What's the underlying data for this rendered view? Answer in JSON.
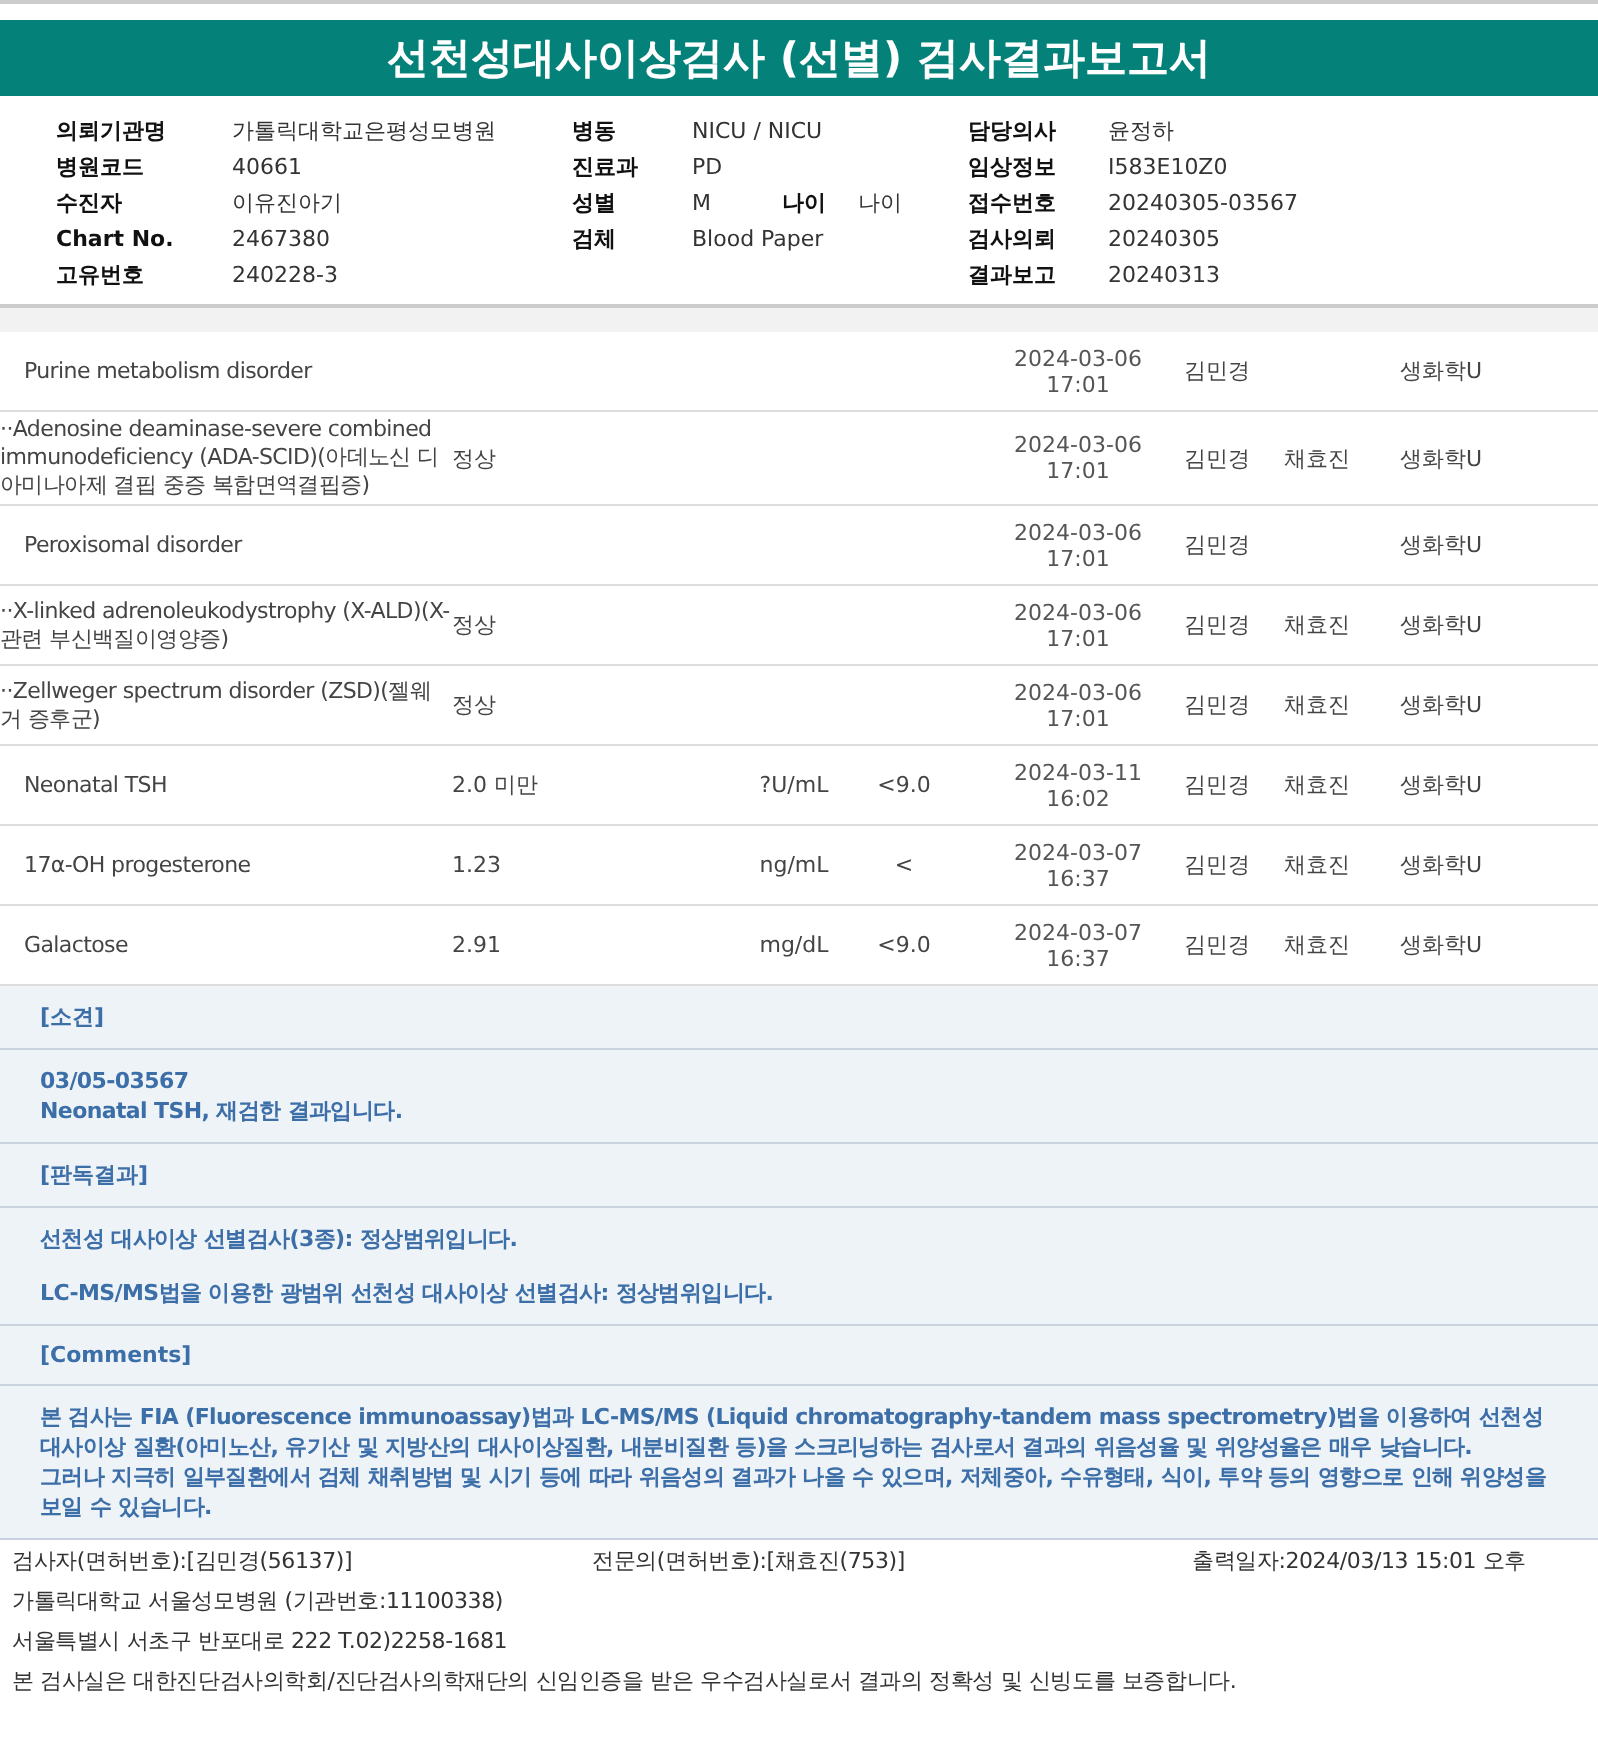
{
  "title": "선천성대사이상검사 (선별) 검사결과보고서",
  "info": [
    [
      {
        "label": "의뢰기관명",
        "value": "가톨릭대학교은평성모병원"
      },
      {
        "label": "병원코드",
        "value": "40661"
      },
      {
        "label": "수진자",
        "value": "이유진아기"
      },
      {
        "label": "Chart No.",
        "value": "2467380"
      },
      {
        "label": "고유번호",
        "value": "240228-3"
      }
    ],
    [
      {
        "label": "병동",
        "value": "NICU / NICU"
      },
      {
        "label": "진료과",
        "value": "PD"
      },
      {
        "label": "성별",
        "value": "M",
        "extra_label": "나이",
        "extra_value": "나이"
      },
      {
        "label": "검체",
        "value": "Blood Paper"
      }
    ],
    [
      {
        "label": "담당의사",
        "value": "윤정하"
      },
      {
        "label": "임상정보",
        "value": "I583E10Z0"
      },
      {
        "label": "접수번호",
        "value": "20240305-03567"
      },
      {
        "label": "검사의뢰",
        "value": "20240305"
      },
      {
        "label": "결과보고",
        "value": "20240313"
      }
    ]
  ],
  "rows": [
    {
      "name": "Purine metabolism disorder",
      "date": "2024-03-06",
      "time": "17:01",
      "tester": "김민경",
      "department": "생화학U"
    },
    {
      "name": "··Adenosine deaminase-severe combined immunodeficiency (ADA-SCID)(아데노신 디아미나아제 결핍 중증 복합면역결핍증)",
      "result": "정상",
      "date": "2024-03-06",
      "time": "17:01",
      "tester": "김민경",
      "specialist": "채효진",
      "department": "생화학U"
    },
    {
      "name": "Peroxisomal disorder",
      "date": "2024-03-06",
      "time": "17:01",
      "tester": "김민경",
      "department": "생화학U"
    },
    {
      "name": "··X-linked adrenoleukodystrophy (X-ALD)(X-관련 부신백질이영양증)",
      "result": "정상",
      "date": "2024-03-06",
      "time": "17:01",
      "tester": "김민경",
      "specialist": "채효진",
      "department": "생화학U"
    },
    {
      "name": "··Zellweger spectrum disorder (ZSD)(젤웨거 증후군)",
      "result": "정상",
      "date": "2024-03-06",
      "time": "17:01",
      "tester": "김민경",
      "specialist": "채효진",
      "department": "생화학U"
    },
    {
      "name": "Neonatal TSH",
      "result": "2.0 미만",
      "unit": "?U/mL",
      "reference": "<9.0",
      "date": "2024-03-11",
      "time": "16:02",
      "tester": "김민경",
      "specialist": "채효진",
      "department": "생화학U"
    },
    {
      "name": "17α-OH progesterone",
      "result": "1.23",
      "unit": "ng/mL",
      "reference": "<",
      "date": "2024-03-07",
      "time": "16:37",
      "tester": "김민경",
      "specialist": "채효진",
      "department": "생화학U"
    },
    {
      "name": "Galactose",
      "result": "2.91",
      "unit": "mg/dL",
      "reference": "<9.0",
      "date": "2024-03-07",
      "time": "16:37",
      "tester": "김민경",
      "specialist": "채효진",
      "department": "생화학U"
    }
  ],
  "notes": [
    {
      "kind": "header",
      "text": "[소견]"
    },
    {
      "kind": "body",
      "paragraphs": [
        "03/05-03567",
        "Neonatal TSH, 재검한 결과입니다."
      ]
    },
    {
      "kind": "header",
      "text": "[판독결과]"
    },
    {
      "kind": "body",
      "spaced": true,
      "paragraphs": [
        "선천성 대사이상 선별검사(3종): 정상범위입니다.",
        "LC-MS/MS법을 이용한 광범위 선천성 대사이상 선별검사: 정상범위입니다."
      ]
    },
    {
      "kind": "header",
      "text": "[Comments]"
    },
    {
      "kind": "body",
      "paragraphs": [
        "본 검사는 FIA (Fluorescence immunoassay)법과 LC-MS/MS (Liquid chromatography-tandem mass spectrometry)법을 이용하여 선천성 대사이상 질환(아미노산, 유기산 및 지방산의 대사이상질환, 내분비질환 등)을 스크리닝하는 검사로서 결과의 위음성율 및 위양성율은 매우 낮습니다.",
        "그러나 지극히 일부질환에서 검체 채취방법 및 시기 등에 따라 위음성의 결과가 나올 수 있으며, 저체중아, 수유형태, 식이, 투약 등의 영향으로 인해 위양성을 보일 수 있습니다."
      ]
    }
  ],
  "footer": {
    "tester": "검사자(면허번호):[김민경(56137)]",
    "specialist": "전문의(면허번호):[채효진(753)]",
    "printed": "출력일자:2024/03/13 15:01 오후",
    "lines": [
      "가톨릭대학교 서울성모병원 (기관번호:11100338)",
      "서울특별시 서초구 반포대로 222 T.02)2258-1681",
      "본 검사실은 대한진단검사의학회/진단검사의학재단의 신임인증을 받은 우수검사실로서 결과의 정확성 및 신빙도를 보증합니다."
    ]
  }
}
